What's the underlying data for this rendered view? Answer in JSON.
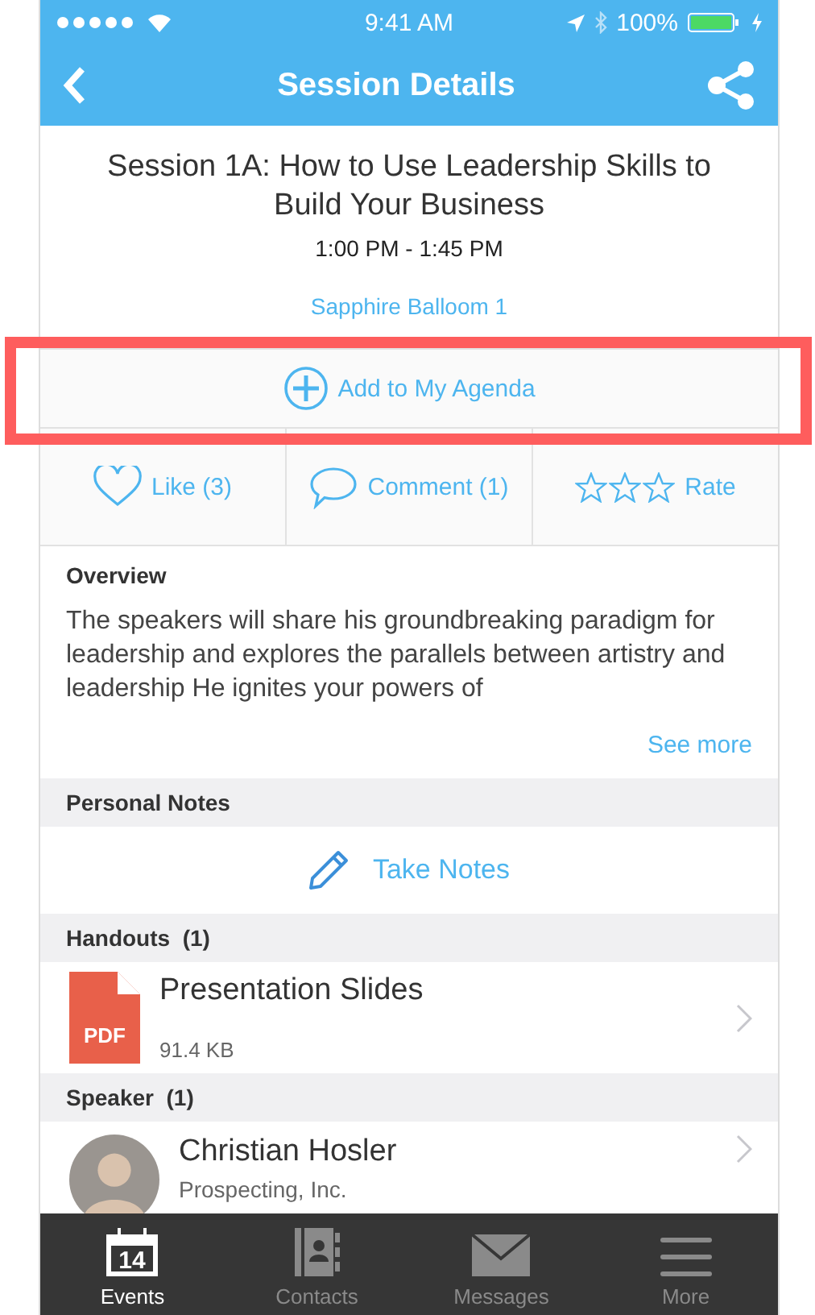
{
  "status_bar": {
    "time": "9:41 AM",
    "battery": "100%"
  },
  "nav": {
    "title": "Session Details"
  },
  "session": {
    "title": "Session 1A: How to Use Leadership Skills to Build Your Business",
    "time": "1:00 PM - 1:45 PM",
    "location": "Sapphire Balloom 1"
  },
  "agenda_button": {
    "label": "Add to My Agenda"
  },
  "actions": [
    {
      "kind": "like",
      "label": "Like (3)"
    },
    {
      "kind": "comment",
      "label": "Comment (1)"
    },
    {
      "kind": "rate",
      "label": "Rate",
      "stars": 0
    }
  ],
  "overview": {
    "heading": "Overview",
    "text": "The speakers will share his groundbreaking paradigm for leadership and explores the parallels between artistry and leadership He ignites your powers of",
    "link": "See more"
  },
  "notes": {
    "heading": "Personal Notes",
    "button": "Take Notes"
  },
  "handouts": {
    "heading": "Handouts  (1)",
    "items": [
      {
        "title": "Presentation Slides",
        "badge": "PDF",
        "size": "91.4 KB"
      }
    ]
  },
  "speaker": {
    "heading": "Speaker  (1)",
    "items": [
      {
        "name": "Christian Hosler",
        "company": "Prospecting, Inc."
      }
    ]
  },
  "tabs": [
    {
      "kind": "events",
      "label": "Events",
      "day": "14",
      "selected": true
    },
    {
      "kind": "contacts",
      "label": "Contacts",
      "selected": false
    },
    {
      "kind": "messages",
      "label": "Messages",
      "selected": false
    },
    {
      "kind": "more",
      "label": "More",
      "selected": false
    }
  ]
}
